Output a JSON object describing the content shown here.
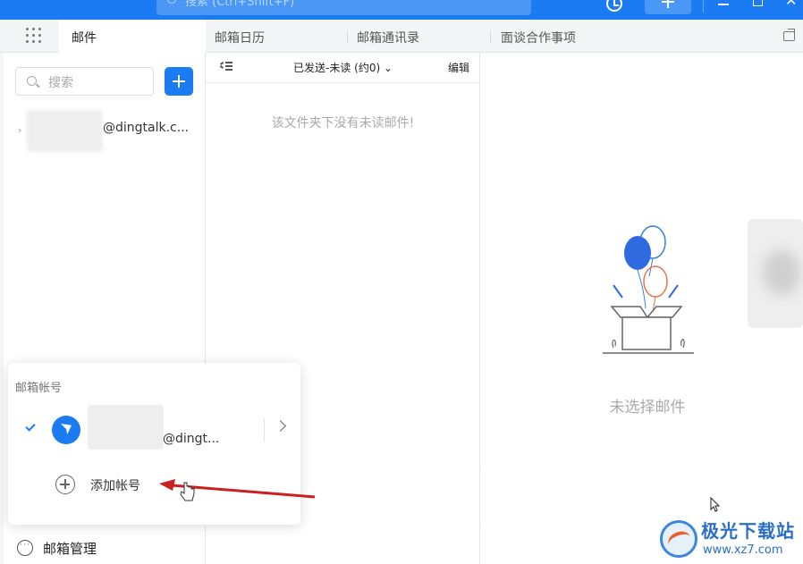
{
  "topbar": {
    "search_placeholder": "搜索 (Ctrl+Shift+F)",
    "accent_color": "#1a7bf2"
  },
  "tabs": [
    {
      "label": "邮件",
      "active": true
    },
    {
      "label": "邮箱日历",
      "active": false
    },
    {
      "label": "邮箱通讯录",
      "active": false
    },
    {
      "label": "面谈合作事项",
      "active": false
    }
  ],
  "sidebar": {
    "search_placeholder": "搜索",
    "account_email": "@dingtalk.c...",
    "manage_label": "邮箱管理"
  },
  "maillist": {
    "folder_title": "已发送-未读 (约0)",
    "edit_label": "编辑",
    "empty_message": "该文件夹下没有未读邮件!"
  },
  "reading_pane": {
    "no_selection": "未选择邮件"
  },
  "account_popup": {
    "title": "邮箱帐号",
    "account_email": "@dingt...",
    "add_account_label": "添加帐号"
  },
  "watermark": {
    "name": "极光下载站",
    "url": "www.xz7.com"
  },
  "icons": [
    "search-icon",
    "history-icon",
    "plus-icon",
    "minimize-icon",
    "maximize-icon",
    "close-icon",
    "apps-grid-icon",
    "popout-icon",
    "compose-icon",
    "list-toggle-icon",
    "chevron-down-icon",
    "check-icon",
    "chevron-right-icon",
    "add-circle-icon",
    "more-circle-icon"
  ]
}
